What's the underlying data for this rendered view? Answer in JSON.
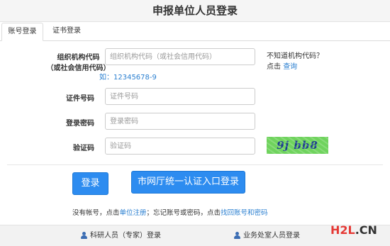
{
  "header": {
    "title": "申报单位人员登录"
  },
  "tabs": [
    {
      "label": "账号登录",
      "active": true
    },
    {
      "label": "证书登录",
      "active": false
    }
  ],
  "form": {
    "org_code": {
      "label_line1": "组织机构代码",
      "label_line2": "（或社会信用代码）",
      "placeholder": "组织机构代码（或社会信用代码）",
      "value": ""
    },
    "example": "如：12345678-9",
    "help": {
      "question": "不知道机构代码？",
      "prefix": "点击",
      "link": "查询"
    },
    "cert_no": {
      "label": "证件号码",
      "placeholder": "证件号码",
      "value": ""
    },
    "password": {
      "label": "登录密码",
      "placeholder": "登录密码",
      "value": ""
    },
    "captcha": {
      "label": "验证码",
      "placeholder": "验证码",
      "value": "",
      "image_text": "9j bb8"
    }
  },
  "buttons": {
    "login": "登录",
    "city_auth": "市网厅统一认证入口登录"
  },
  "hint": {
    "t1": "没有帐号，点击",
    "link1": "单位注册",
    "t2": "；忘记账号或密码，点击",
    "link2": "找回账号和密码"
  },
  "footer": {
    "researcher": "科研人员（专家）登录",
    "office": "业务处室人员登录"
  },
  "watermark": {
    "part1": "H2L",
    "part2": ".CN"
  },
  "colors": {
    "accent": "#2d8cf0",
    "link": "#2a7fd0",
    "captcha_bg": "#6fd35d"
  }
}
